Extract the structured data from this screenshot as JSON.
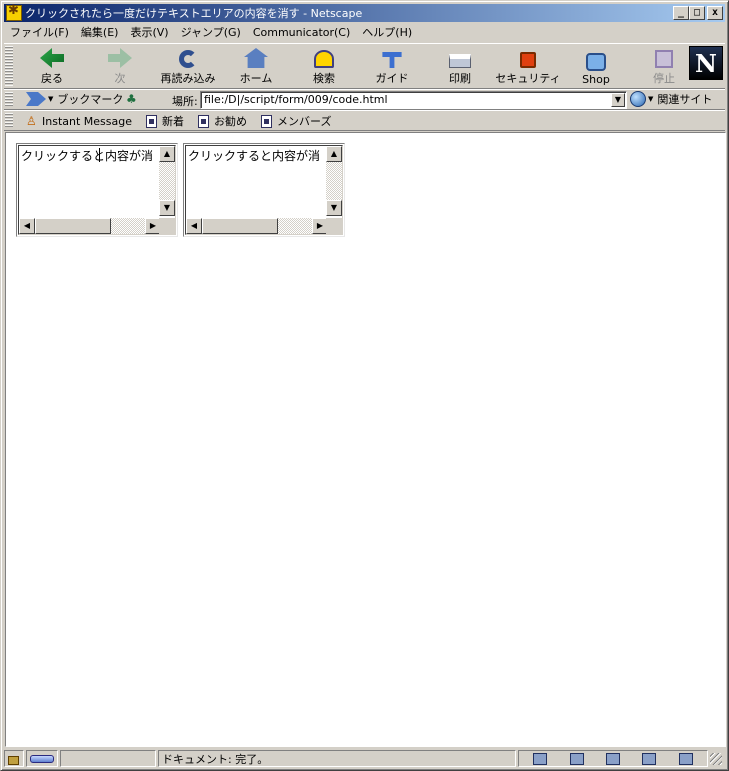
{
  "window": {
    "title": "クリックされたら一度だけテキストエリアの内容を消す - Netscape",
    "minimize": "_",
    "maximize": "□",
    "close": "x"
  },
  "menu": [
    "ファイル(F)",
    "編集(E)",
    "表示(V)",
    "ジャンプ(G)",
    "Communicator(C)",
    "ヘルプ(H)"
  ],
  "nav_toolbar": {
    "buttons": [
      {
        "label": "戻る",
        "icon": "back-arrow",
        "enabled": true
      },
      {
        "label": "次",
        "icon": "forward-arrow",
        "enabled": false
      },
      {
        "label": "再読み込み",
        "icon": "reload",
        "enabled": true
      },
      {
        "label": "ホーム",
        "icon": "home",
        "enabled": true
      },
      {
        "label": "検索",
        "icon": "search",
        "enabled": true
      },
      {
        "label": "ガイド",
        "icon": "guide",
        "enabled": true
      },
      {
        "label": "印刷",
        "icon": "print",
        "enabled": true
      },
      {
        "label": "セキュリティ",
        "icon": "security-lock",
        "enabled": true
      },
      {
        "label": "Shop",
        "icon": "shop",
        "enabled": true
      },
      {
        "label": "停止",
        "icon": "stop",
        "enabled": false
      }
    ],
    "logo": "N"
  },
  "location_toolbar": {
    "bookmarks_label": "ブックマーク",
    "location_label": "場所:",
    "url": "file:/D|/script/form/009/code.html",
    "related_label": "関連サイト"
  },
  "personal_toolbar": {
    "items": [
      "Instant Message",
      "新着",
      "お勧め",
      "メンバーズ"
    ]
  },
  "page": {
    "textarea1": "クリックすると内容が消",
    "textarea2": "クリックすると内容が消"
  },
  "status": {
    "text": "ドキュメント: 完了。"
  }
}
